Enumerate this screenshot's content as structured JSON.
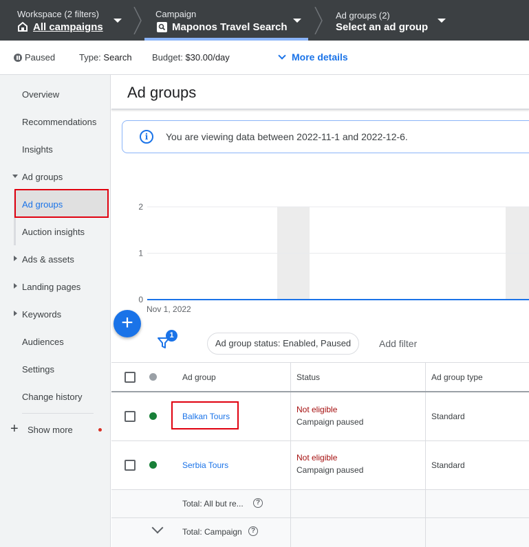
{
  "breadcrumbs": [
    {
      "sub": "Workspace (2 filters)",
      "main": "All campaigns",
      "icon": "home-icon"
    },
    {
      "sub": "Campaign",
      "main": "Maponos Travel Search",
      "icon": "search-campaign-icon"
    },
    {
      "sub": "Ad groups (2)",
      "main": "Select an ad group"
    }
  ],
  "status_bar": {
    "status": "Paused",
    "type_label": "Type:",
    "type_value": "Search",
    "budget_label": "Budget:",
    "budget_value": "$30.00/day",
    "more_details": "More details"
  },
  "sidebar": {
    "items": [
      {
        "label": "Overview"
      },
      {
        "label": "Recommendations"
      },
      {
        "label": "Insights"
      },
      {
        "label": "Ad groups",
        "expanded": true
      },
      {
        "label": "Ad groups",
        "selected": true
      },
      {
        "label": "Auction insights"
      },
      {
        "label": "Ads & assets"
      },
      {
        "label": "Landing pages"
      },
      {
        "label": "Keywords"
      },
      {
        "label": "Audiences"
      },
      {
        "label": "Settings"
      },
      {
        "label": "Change history"
      }
    ],
    "show_more": "Show more"
  },
  "page": {
    "title": "Ad groups",
    "info_banner": "You are viewing data between 2022-11-1 and 2022-12-6."
  },
  "chart_data": {
    "type": "line",
    "x": [
      "Nov 1, 2022"
    ],
    "y_ticks": [
      "2",
      "1",
      "0"
    ],
    "ylim": [
      0,
      2
    ],
    "x_start_label": "Nov 1, 2022",
    "series": [
      {
        "values": [
          0
        ]
      }
    ]
  },
  "filters": {
    "badge_count": "1",
    "chip": "Ad group status: Enabled, Paused",
    "add_filter": "Add filter"
  },
  "table": {
    "columns": [
      "Ad group",
      "Status",
      "Ad group type"
    ],
    "rows": [
      {
        "name": "Balkan Tours",
        "status": "Not eligible",
        "status_detail": "Campaign paused",
        "type": "Standard",
        "dot_color": "#188038"
      },
      {
        "name": "Serbia Tours",
        "status": "Not eligible",
        "status_detail": "Campaign paused",
        "type": "Standard",
        "dot_color": "#188038"
      }
    ],
    "totals": [
      {
        "label": "Total: All but re..."
      },
      {
        "label": "Total: Campaign"
      }
    ]
  },
  "colors": {
    "accent": "#1a73e8",
    "topbar": "#3c4043",
    "highlight": "#e0000f",
    "status_error": "#a50e0e"
  }
}
